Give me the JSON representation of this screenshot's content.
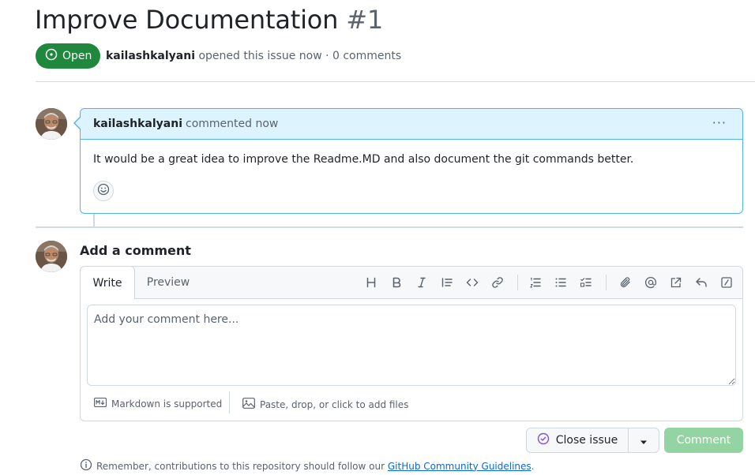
{
  "issue": {
    "title": "Improve Documentation",
    "number": "#1",
    "state": "Open",
    "author": "kailashkalyani",
    "meta_text": "opened this issue now · 0 comments"
  },
  "comment": {
    "author": "kailashkalyani",
    "time": "commented now",
    "body": "It would be a great idea to improve the Readme.MD and also document the git commands better.",
    "menu_label": "···"
  },
  "new_comment": {
    "heading": "Add a comment",
    "tab_write": "Write",
    "tab_preview": "Preview",
    "placeholder": "Add your comment here...",
    "markdown_note": "Markdown is supported",
    "files_note": "Paste, drop, or click to add files",
    "toolbar_icons": [
      "heading-icon",
      "bold-icon",
      "italic-icon",
      "quote-icon",
      "code-icon",
      "link-icon",
      "numbered-list-icon",
      "unordered-list-icon",
      "task-list-icon",
      "attach-icon",
      "mention-icon",
      "cross-reference-icon",
      "saved-reply-icon",
      "slash-command-icon"
    ]
  },
  "actions": {
    "close_issue": "Close issue",
    "comment": "Comment"
  },
  "footer": {
    "prefix": "Remember, contributions to this repository should follow our",
    "link_text": "GitHub Community Guidelines",
    "suffix": "."
  },
  "colors": {
    "open_green": "#1f883d",
    "comment_header_bg": "#ddf4ff",
    "comment_border": "#54aeff",
    "link_blue": "#0969da",
    "comment_button_disabled": "#94d3a2"
  }
}
